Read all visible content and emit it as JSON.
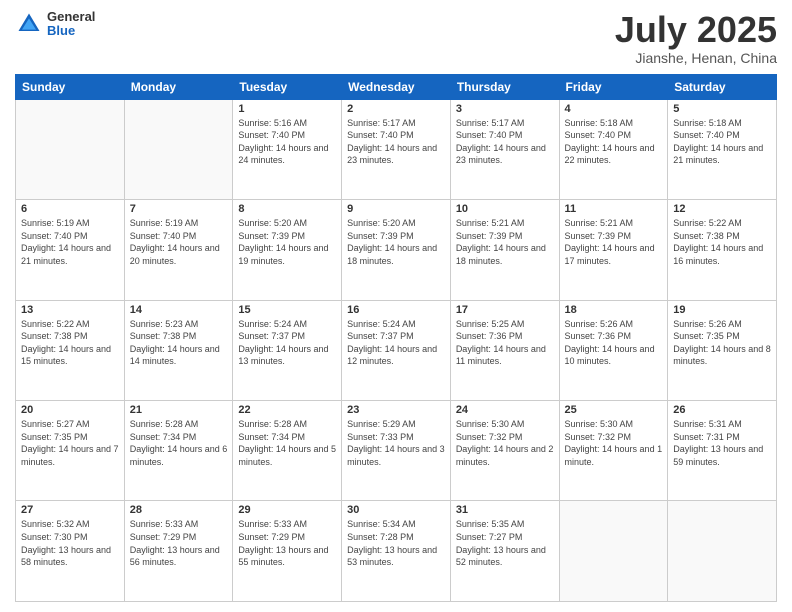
{
  "header": {
    "logo": {
      "general": "General",
      "blue": "Blue"
    },
    "title": "July 2025",
    "subtitle": "Jianshe, Henan, China"
  },
  "weekdays": [
    "Sunday",
    "Monday",
    "Tuesday",
    "Wednesday",
    "Thursday",
    "Friday",
    "Saturday"
  ],
  "weeks": [
    [
      {
        "day": "",
        "sunrise": "",
        "sunset": "",
        "daylight": ""
      },
      {
        "day": "",
        "sunrise": "",
        "sunset": "",
        "daylight": ""
      },
      {
        "day": "1",
        "sunrise": "Sunrise: 5:16 AM",
        "sunset": "Sunset: 7:40 PM",
        "daylight": "Daylight: 14 hours and 24 minutes."
      },
      {
        "day": "2",
        "sunrise": "Sunrise: 5:17 AM",
        "sunset": "Sunset: 7:40 PM",
        "daylight": "Daylight: 14 hours and 23 minutes."
      },
      {
        "day": "3",
        "sunrise": "Sunrise: 5:17 AM",
        "sunset": "Sunset: 7:40 PM",
        "daylight": "Daylight: 14 hours and 23 minutes."
      },
      {
        "day": "4",
        "sunrise": "Sunrise: 5:18 AM",
        "sunset": "Sunset: 7:40 PM",
        "daylight": "Daylight: 14 hours and 22 minutes."
      },
      {
        "day": "5",
        "sunrise": "Sunrise: 5:18 AM",
        "sunset": "Sunset: 7:40 PM",
        "daylight": "Daylight: 14 hours and 21 minutes."
      }
    ],
    [
      {
        "day": "6",
        "sunrise": "Sunrise: 5:19 AM",
        "sunset": "Sunset: 7:40 PM",
        "daylight": "Daylight: 14 hours and 21 minutes."
      },
      {
        "day": "7",
        "sunrise": "Sunrise: 5:19 AM",
        "sunset": "Sunset: 7:40 PM",
        "daylight": "Daylight: 14 hours and 20 minutes."
      },
      {
        "day": "8",
        "sunrise": "Sunrise: 5:20 AM",
        "sunset": "Sunset: 7:39 PM",
        "daylight": "Daylight: 14 hours and 19 minutes."
      },
      {
        "day": "9",
        "sunrise": "Sunrise: 5:20 AM",
        "sunset": "Sunset: 7:39 PM",
        "daylight": "Daylight: 14 hours and 18 minutes."
      },
      {
        "day": "10",
        "sunrise": "Sunrise: 5:21 AM",
        "sunset": "Sunset: 7:39 PM",
        "daylight": "Daylight: 14 hours and 18 minutes."
      },
      {
        "day": "11",
        "sunrise": "Sunrise: 5:21 AM",
        "sunset": "Sunset: 7:39 PM",
        "daylight": "Daylight: 14 hours and 17 minutes."
      },
      {
        "day": "12",
        "sunrise": "Sunrise: 5:22 AM",
        "sunset": "Sunset: 7:38 PM",
        "daylight": "Daylight: 14 hours and 16 minutes."
      }
    ],
    [
      {
        "day": "13",
        "sunrise": "Sunrise: 5:22 AM",
        "sunset": "Sunset: 7:38 PM",
        "daylight": "Daylight: 14 hours and 15 minutes."
      },
      {
        "day": "14",
        "sunrise": "Sunrise: 5:23 AM",
        "sunset": "Sunset: 7:38 PM",
        "daylight": "Daylight: 14 hours and 14 minutes."
      },
      {
        "day": "15",
        "sunrise": "Sunrise: 5:24 AM",
        "sunset": "Sunset: 7:37 PM",
        "daylight": "Daylight: 14 hours and 13 minutes."
      },
      {
        "day": "16",
        "sunrise": "Sunrise: 5:24 AM",
        "sunset": "Sunset: 7:37 PM",
        "daylight": "Daylight: 14 hours and 12 minutes."
      },
      {
        "day": "17",
        "sunrise": "Sunrise: 5:25 AM",
        "sunset": "Sunset: 7:36 PM",
        "daylight": "Daylight: 14 hours and 11 minutes."
      },
      {
        "day": "18",
        "sunrise": "Sunrise: 5:26 AM",
        "sunset": "Sunset: 7:36 PM",
        "daylight": "Daylight: 14 hours and 10 minutes."
      },
      {
        "day": "19",
        "sunrise": "Sunrise: 5:26 AM",
        "sunset": "Sunset: 7:35 PM",
        "daylight": "Daylight: 14 hours and 8 minutes."
      }
    ],
    [
      {
        "day": "20",
        "sunrise": "Sunrise: 5:27 AM",
        "sunset": "Sunset: 7:35 PM",
        "daylight": "Daylight: 14 hours and 7 minutes."
      },
      {
        "day": "21",
        "sunrise": "Sunrise: 5:28 AM",
        "sunset": "Sunset: 7:34 PM",
        "daylight": "Daylight: 14 hours and 6 minutes."
      },
      {
        "day": "22",
        "sunrise": "Sunrise: 5:28 AM",
        "sunset": "Sunset: 7:34 PM",
        "daylight": "Daylight: 14 hours and 5 minutes."
      },
      {
        "day": "23",
        "sunrise": "Sunrise: 5:29 AM",
        "sunset": "Sunset: 7:33 PM",
        "daylight": "Daylight: 14 hours and 3 minutes."
      },
      {
        "day": "24",
        "sunrise": "Sunrise: 5:30 AM",
        "sunset": "Sunset: 7:32 PM",
        "daylight": "Daylight: 14 hours and 2 minutes."
      },
      {
        "day": "25",
        "sunrise": "Sunrise: 5:30 AM",
        "sunset": "Sunset: 7:32 PM",
        "daylight": "Daylight: 14 hours and 1 minute."
      },
      {
        "day": "26",
        "sunrise": "Sunrise: 5:31 AM",
        "sunset": "Sunset: 7:31 PM",
        "daylight": "Daylight: 13 hours and 59 minutes."
      }
    ],
    [
      {
        "day": "27",
        "sunrise": "Sunrise: 5:32 AM",
        "sunset": "Sunset: 7:30 PM",
        "daylight": "Daylight: 13 hours and 58 minutes."
      },
      {
        "day": "28",
        "sunrise": "Sunrise: 5:33 AM",
        "sunset": "Sunset: 7:29 PM",
        "daylight": "Daylight: 13 hours and 56 minutes."
      },
      {
        "day": "29",
        "sunrise": "Sunrise: 5:33 AM",
        "sunset": "Sunset: 7:29 PM",
        "daylight": "Daylight: 13 hours and 55 minutes."
      },
      {
        "day": "30",
        "sunrise": "Sunrise: 5:34 AM",
        "sunset": "Sunset: 7:28 PM",
        "daylight": "Daylight: 13 hours and 53 minutes."
      },
      {
        "day": "31",
        "sunrise": "Sunrise: 5:35 AM",
        "sunset": "Sunset: 7:27 PM",
        "daylight": "Daylight: 13 hours and 52 minutes."
      },
      {
        "day": "",
        "sunrise": "",
        "sunset": "",
        "daylight": ""
      },
      {
        "day": "",
        "sunrise": "",
        "sunset": "",
        "daylight": ""
      }
    ]
  ]
}
